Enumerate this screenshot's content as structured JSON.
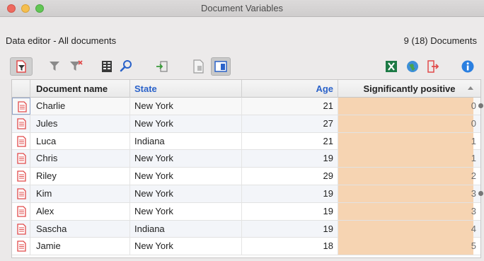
{
  "window": {
    "title": "Document Variables"
  },
  "info": {
    "subtitle": "Data editor - All documents",
    "count": "9 (18) Documents"
  },
  "toolbar": {
    "left": [
      "doc-filter-icon",
      "filter-icon",
      "clear-filter-icon",
      "columns-icon",
      "search-icon",
      "import-icon",
      "doc-view-icon",
      "panel-toggle-icon"
    ],
    "right": [
      "excel-export-icon",
      "web-export-icon",
      "export-icon",
      "info-icon"
    ]
  },
  "columns": {
    "name": "Document name",
    "state": "State",
    "age": "Age",
    "sig": "Significantly positive"
  },
  "colors": {
    "accent_blue": "#2a62c9",
    "sig_fill": "#f6d4b2",
    "doc_icon": "#e14b4b"
  },
  "rows": [
    {
      "name": "Charlie",
      "state": "New York",
      "age": "21",
      "sig": "0",
      "sig_fill": 0.95,
      "dot": true
    },
    {
      "name": "Jules",
      "state": "New York",
      "age": "27",
      "sig": "0",
      "sig_fill": 0.95,
      "dot": false
    },
    {
      "name": "Luca",
      "state": "Indiana",
      "age": "21",
      "sig": "1",
      "sig_fill": 0.95,
      "dot": false
    },
    {
      "name": "Chris",
      "state": "New York",
      "age": "19",
      "sig": "1",
      "sig_fill": 0.95,
      "dot": false
    },
    {
      "name": "Riley",
      "state": "New York",
      "age": "29",
      "sig": "2",
      "sig_fill": 0.95,
      "dot": false
    },
    {
      "name": "Kim",
      "state": "New York",
      "age": "19",
      "sig": "3",
      "sig_fill": 0.95,
      "dot": true
    },
    {
      "name": "Alex",
      "state": "New York",
      "age": "19",
      "sig": "3",
      "sig_fill": 0.95,
      "dot": false
    },
    {
      "name": "Sascha",
      "state": "Indiana",
      "age": "19",
      "sig": "4",
      "sig_fill": 0.95,
      "dot": false
    },
    {
      "name": "Jamie",
      "state": "New York",
      "age": "18",
      "sig": "5",
      "sig_fill": 0.95,
      "dot": false
    }
  ]
}
